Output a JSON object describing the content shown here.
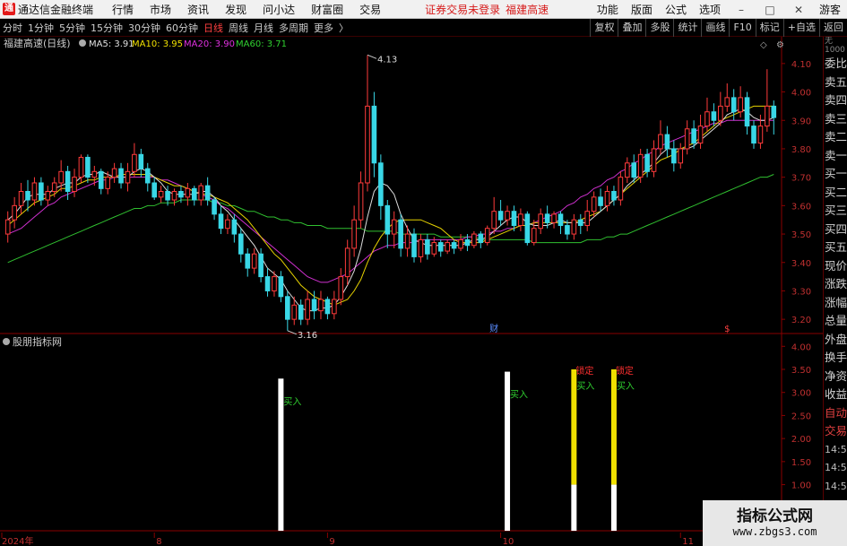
{
  "app": {
    "title": "通达信金融终端",
    "logo": "通"
  },
  "menu": {
    "items": [
      "行情",
      "市场",
      "资讯",
      "发现",
      "问小达",
      "财富圈",
      "交易"
    ],
    "alert": "证券交易未登录",
    "stock": "福建高速",
    "right_items": [
      "功能",
      "版面",
      "公式",
      "选项"
    ],
    "guest": "游客"
  },
  "toolbar": {
    "periods": [
      "分时",
      "1分钟",
      "5分钟",
      "15分钟",
      "30分钟",
      "60分钟",
      "日线",
      "周线",
      "月线",
      "多周期",
      "更多"
    ],
    "active": "日线",
    "right_items": [
      "复权",
      "叠加",
      "多股",
      "统计",
      "画线",
      "F10",
      "标记",
      "+自选",
      "返回"
    ]
  },
  "sidebar": {
    "header": "无",
    "header_sub": "1000",
    "items": [
      "委比",
      "卖五",
      "卖四",
      "卖三",
      "卖二",
      "卖一",
      "买一",
      "买二",
      "买三",
      "买四",
      "买五",
      "现价",
      "涨跌",
      "涨幅",
      "总量",
      "外盘",
      "换手",
      "净资",
      "收益",
      "自动",
      "交易",
      "14:56",
      "14:56",
      "14:56",
      "14:56",
      "14:56",
      "14:56",
      "14:56"
    ]
  },
  "main_chart": {
    "title": "福建高速(日线)",
    "ma_labels": [
      {
        "text": "MA5: 3.91",
        "color": "#e0e0e0"
      },
      {
        "text": "MA10: 3.95",
        "color": "#f0e000"
      },
      {
        "text": "MA20: 3.90",
        "color": "#e030e0"
      },
      {
        "text": "MA60: 3.71",
        "color": "#30d030"
      }
    ],
    "high_label": "4.13",
    "low_label": "3.16",
    "axis_ticks": [
      "4.10",
      "4.00",
      "3.90",
      "3.80",
      "3.70",
      "3.60",
      "3.50",
      "3.40",
      "3.30",
      "3.20"
    ],
    "markers": {
      "cai": "财",
      "dollar": "$"
    }
  },
  "indicator": {
    "title": "股朋指标网",
    "axis_ticks": [
      "4.00",
      "3.50",
      "3.00",
      "2.50",
      "2.00",
      "1.50",
      "1.00",
      "0.50"
    ],
    "buy_label": "买入",
    "lock_label": "锁定"
  },
  "x_axis": {
    "labels": [
      "2024年",
      "8",
      "9",
      "10",
      "11",
      "12",
      "1"
    ]
  },
  "watermark": {
    "line1": "指标公式网",
    "line2": "www.zbgs3.com"
  },
  "chart_data": {
    "type": "candlestick",
    "title": "福建高速(日线)",
    "price_axis": [
      3.15,
      4.15
    ],
    "high": {
      "value": 4.13,
      "label": "4.13"
    },
    "low": {
      "value": 3.16,
      "label": "3.16"
    },
    "candles": [
      [
        3.5,
        3.55,
        3.47,
        3.58
      ],
      [
        3.55,
        3.6,
        3.52,
        3.63
      ],
      [
        3.6,
        3.65,
        3.57,
        3.68
      ],
      [
        3.65,
        3.62,
        3.58,
        3.69
      ],
      [
        3.62,
        3.68,
        3.6,
        3.7
      ],
      [
        3.68,
        3.62,
        3.6,
        3.7
      ],
      [
        3.62,
        3.65,
        3.6,
        3.67
      ],
      [
        3.65,
        3.68,
        3.63,
        3.7
      ],
      [
        3.68,
        3.72,
        3.65,
        3.76
      ],
      [
        3.72,
        3.65,
        3.62,
        3.74
      ],
      [
        3.65,
        3.7,
        3.63,
        3.73
      ],
      [
        3.7,
        3.77,
        3.68,
        3.78
      ],
      [
        3.77,
        3.7,
        3.68,
        3.78
      ],
      [
        3.7,
        3.72,
        3.67,
        3.74
      ],
      [
        3.72,
        3.66,
        3.64,
        3.73
      ],
      [
        3.66,
        3.7,
        3.64,
        3.72
      ],
      [
        3.7,
        3.73,
        3.68,
        3.75
      ],
      [
        3.73,
        3.68,
        3.66,
        3.75
      ],
      [
        3.68,
        3.72,
        3.65,
        3.75
      ],
      [
        3.72,
        3.78,
        3.7,
        3.82
      ],
      [
        3.78,
        3.73,
        3.7,
        3.8
      ],
      [
        3.73,
        3.68,
        3.65,
        3.75
      ],
      [
        3.68,
        3.63,
        3.62,
        3.7
      ],
      [
        3.63,
        3.65,
        3.61,
        3.67
      ],
      [
        3.65,
        3.62,
        3.6,
        3.67
      ],
      [
        3.62,
        3.65,
        3.6,
        3.66
      ],
      [
        3.65,
        3.63,
        3.61,
        3.67
      ],
      [
        3.63,
        3.66,
        3.6,
        3.68
      ],
      [
        3.66,
        3.62,
        3.6,
        3.67
      ],
      [
        3.62,
        3.67,
        3.6,
        3.68
      ],
      [
        3.67,
        3.62,
        3.6,
        3.7
      ],
      [
        3.62,
        3.57,
        3.55,
        3.63
      ],
      [
        3.57,
        3.52,
        3.5,
        3.6
      ],
      [
        3.52,
        3.55,
        3.5,
        3.57
      ],
      [
        3.55,
        3.5,
        3.47,
        3.57
      ],
      [
        3.5,
        3.43,
        3.4,
        3.52
      ],
      [
        3.43,
        3.38,
        3.35,
        3.45
      ],
      [
        3.38,
        3.43,
        3.36,
        3.45
      ],
      [
        3.43,
        3.35,
        3.33,
        3.45
      ],
      [
        3.35,
        3.3,
        3.28,
        3.38
      ],
      [
        3.3,
        3.35,
        3.28,
        3.37
      ],
      [
        3.35,
        3.28,
        3.26,
        3.37
      ],
      [
        3.28,
        3.2,
        3.16,
        3.3
      ],
      [
        3.2,
        3.25,
        3.18,
        3.28
      ],
      [
        3.25,
        3.2,
        3.18,
        3.27
      ],
      [
        3.2,
        3.27,
        3.18,
        3.3
      ],
      [
        3.27,
        3.23,
        3.2,
        3.3
      ],
      [
        3.23,
        3.27,
        3.2,
        3.3
      ],
      [
        3.27,
        3.22,
        3.2,
        3.28
      ],
      [
        3.22,
        3.27,
        3.2,
        3.3
      ],
      [
        3.27,
        3.35,
        3.25,
        3.38
      ],
      [
        3.35,
        3.45,
        3.32,
        3.48
      ],
      [
        3.45,
        3.55,
        3.42,
        3.6
      ],
      [
        3.55,
        3.68,
        3.52,
        3.72
      ],
      [
        3.68,
        3.95,
        3.65,
        4.13
      ],
      [
        3.95,
        3.75,
        3.7,
        4.0
      ],
      [
        3.75,
        3.6,
        3.55,
        3.78
      ],
      [
        3.6,
        3.5,
        3.45,
        3.62
      ],
      [
        3.5,
        3.55,
        3.45,
        3.58
      ],
      [
        3.55,
        3.45,
        3.42,
        3.57
      ],
      [
        3.45,
        3.5,
        3.42,
        3.53
      ],
      [
        3.5,
        3.42,
        3.4,
        3.52
      ],
      [
        3.42,
        3.48,
        3.4,
        3.5
      ],
      [
        3.48,
        3.43,
        3.41,
        3.5
      ],
      [
        3.43,
        3.47,
        3.42,
        3.49
      ],
      [
        3.47,
        3.44,
        3.42,
        3.48
      ],
      [
        3.44,
        3.47,
        3.43,
        3.48
      ],
      [
        3.47,
        3.45,
        3.43,
        3.48
      ],
      [
        3.45,
        3.48,
        3.44,
        3.5
      ],
      [
        3.48,
        3.46,
        3.44,
        3.5
      ],
      [
        3.46,
        3.5,
        3.45,
        3.51
      ],
      [
        3.5,
        3.47,
        3.45,
        3.51
      ],
      [
        3.47,
        3.52,
        3.46,
        3.53
      ],
      [
        3.52,
        3.58,
        3.5,
        3.63
      ],
      [
        3.58,
        3.55,
        3.53,
        3.62
      ],
      [
        3.55,
        3.58,
        3.53,
        3.6
      ],
      [
        3.58,
        3.53,
        3.51,
        3.6
      ],
      [
        3.53,
        3.57,
        3.51,
        3.59
      ],
      [
        3.57,
        3.47,
        3.46,
        3.58
      ],
      [
        3.47,
        3.52,
        3.46,
        3.55
      ],
      [
        3.52,
        3.57,
        3.5,
        3.59
      ],
      [
        3.57,
        3.54,
        3.52,
        3.6
      ],
      [
        3.54,
        3.57,
        3.52,
        3.58
      ],
      [
        3.57,
        3.53,
        3.5,
        3.58
      ],
      [
        3.53,
        3.5,
        3.48,
        3.55
      ],
      [
        3.5,
        3.55,
        3.48,
        3.57
      ],
      [
        3.55,
        3.53,
        3.5,
        3.57
      ],
      [
        3.53,
        3.58,
        3.51,
        3.62
      ],
      [
        3.58,
        3.63,
        3.56,
        3.65
      ],
      [
        3.63,
        3.6,
        3.58,
        3.66
      ],
      [
        3.6,
        3.65,
        3.58,
        3.67
      ],
      [
        3.65,
        3.62,
        3.6,
        3.67
      ],
      [
        3.62,
        3.7,
        3.6,
        3.72
      ],
      [
        3.7,
        3.75,
        3.68,
        3.77
      ],
      [
        3.75,
        3.7,
        3.68,
        3.78
      ],
      [
        3.7,
        3.78,
        3.68,
        3.8
      ],
      [
        3.78,
        3.72,
        3.7,
        3.8
      ],
      [
        3.72,
        3.8,
        3.7,
        3.83
      ],
      [
        3.8,
        3.85,
        3.78,
        3.9
      ],
      [
        3.85,
        3.8,
        3.77,
        3.88
      ],
      [
        3.8,
        3.75,
        3.72,
        3.83
      ],
      [
        3.75,
        3.8,
        3.73,
        3.82
      ],
      [
        3.8,
        3.87,
        3.78,
        3.9
      ],
      [
        3.87,
        3.82,
        3.8,
        3.9
      ],
      [
        3.82,
        3.88,
        3.8,
        3.92
      ],
      [
        3.88,
        3.93,
        3.86,
        3.98
      ],
      [
        3.93,
        3.9,
        3.88,
        3.96
      ],
      [
        3.9,
        3.95,
        3.88,
        4.0
      ],
      [
        3.95,
        3.98,
        3.93,
        4.03
      ],
      [
        3.98,
        3.93,
        3.9,
        4.01
      ],
      [
        3.93,
        3.98,
        3.91,
        4.02
      ],
      [
        3.98,
        3.88,
        3.85,
        4.0
      ],
      [
        3.88,
        3.82,
        3.8,
        3.9
      ],
      [
        3.82,
        3.88,
        3.8,
        3.92
      ],
      [
        3.88,
        3.95,
        3.86,
        4.08
      ],
      [
        3.95,
        3.91,
        3.85,
        3.97
      ]
    ],
    "ma_current": {
      "MA5": 3.91,
      "MA10": 3.95,
      "MA20": 3.9,
      "MA60": 3.71
    },
    "ma5": [
      3.55,
      3.57,
      3.6,
      3.63,
      3.64,
      3.64,
      3.64,
      3.66,
      3.67,
      3.68,
      3.68,
      3.7,
      3.71,
      3.71,
      3.72,
      3.71,
      3.7,
      3.7,
      3.7,
      3.72,
      3.73,
      3.72,
      3.7,
      3.68,
      3.65,
      3.64,
      3.64,
      3.64,
      3.64,
      3.65,
      3.65,
      3.63,
      3.6,
      3.58,
      3.55,
      3.52,
      3.49,
      3.46,
      3.42,
      3.38,
      3.36,
      3.34,
      3.3,
      3.27,
      3.24,
      3.23,
      3.23,
      3.24,
      3.24,
      3.25,
      3.28,
      3.32,
      3.37,
      3.45,
      3.56,
      3.65,
      3.68,
      3.67,
      3.64,
      3.57,
      3.52,
      3.48,
      3.47,
      3.46,
      3.46,
      3.46,
      3.46,
      3.46,
      3.46,
      3.47,
      3.48,
      3.48,
      3.49,
      3.51,
      3.53,
      3.55,
      3.56,
      3.56,
      3.54,
      3.53,
      3.53,
      3.53,
      3.54,
      3.55,
      3.54,
      3.54,
      3.54,
      3.54,
      3.56,
      3.58,
      3.6,
      3.62,
      3.64,
      3.67,
      3.69,
      3.71,
      3.73,
      3.75,
      3.78,
      3.8,
      3.8,
      3.8,
      3.8,
      3.81,
      3.83,
      3.85,
      3.87,
      3.89,
      3.92,
      3.93,
      3.94,
      3.93,
      3.91,
      3.9,
      3.9,
      3.91
    ],
    "ma10": [
      3.53,
      3.55,
      3.57,
      3.59,
      3.61,
      3.62,
      3.63,
      3.64,
      3.66,
      3.66,
      3.67,
      3.68,
      3.69,
      3.69,
      3.7,
      3.7,
      3.7,
      3.71,
      3.71,
      3.71,
      3.71,
      3.71,
      3.7,
      3.69,
      3.68,
      3.67,
      3.67,
      3.66,
      3.65,
      3.64,
      3.64,
      3.63,
      3.62,
      3.61,
      3.59,
      3.57,
      3.55,
      3.52,
      3.49,
      3.46,
      3.43,
      3.41,
      3.38,
      3.35,
      3.32,
      3.3,
      3.28,
      3.27,
      3.26,
      3.25,
      3.26,
      3.27,
      3.3,
      3.34,
      3.4,
      3.45,
      3.49,
      3.52,
      3.54,
      3.55,
      3.55,
      3.55,
      3.55,
      3.54,
      3.53,
      3.52,
      3.5,
      3.48,
      3.47,
      3.47,
      3.47,
      3.47,
      3.48,
      3.49,
      3.5,
      3.51,
      3.52,
      3.53,
      3.53,
      3.54,
      3.54,
      3.54,
      3.54,
      3.54,
      3.54,
      3.54,
      3.55,
      3.56,
      3.57,
      3.58,
      3.6,
      3.62,
      3.64,
      3.66,
      3.68,
      3.7,
      3.72,
      3.74,
      3.76,
      3.77,
      3.78,
      3.8,
      3.81,
      3.82,
      3.84,
      3.86,
      3.88,
      3.9,
      3.91,
      3.92,
      3.93,
      3.94,
      3.95,
      3.95,
      3.95,
      3.95
    ],
    "ma20": [
      3.5,
      3.51,
      3.52,
      3.54,
      3.56,
      3.58,
      3.6,
      3.61,
      3.63,
      3.64,
      3.65,
      3.66,
      3.67,
      3.68,
      3.69,
      3.69,
      3.7,
      3.7,
      3.7,
      3.7,
      3.7,
      3.7,
      3.7,
      3.69,
      3.69,
      3.68,
      3.67,
      3.66,
      3.65,
      3.64,
      3.63,
      3.62,
      3.6,
      3.59,
      3.57,
      3.55,
      3.53,
      3.51,
      3.49,
      3.47,
      3.45,
      3.43,
      3.41,
      3.39,
      3.37,
      3.35,
      3.34,
      3.33,
      3.33,
      3.34,
      3.35,
      3.36,
      3.38,
      3.4,
      3.42,
      3.44,
      3.45,
      3.46,
      3.46,
      3.47,
      3.47,
      3.47,
      3.48,
      3.48,
      3.48,
      3.48,
      3.48,
      3.48,
      3.48,
      3.49,
      3.49,
      3.5,
      3.5,
      3.51,
      3.51,
      3.52,
      3.52,
      3.53,
      3.53,
      3.54,
      3.55,
      3.56,
      3.57,
      3.58,
      3.6,
      3.61,
      3.63,
      3.64,
      3.66,
      3.67,
      3.69,
      3.7,
      3.72,
      3.73,
      3.75,
      3.76,
      3.78,
      3.79,
      3.81,
      3.82,
      3.83,
      3.84,
      3.85,
      3.86,
      3.87,
      3.88,
      3.89,
      3.89,
      3.9,
      3.9,
      3.9,
      3.9,
      3.9,
      3.9,
      3.9,
      3.9
    ],
    "ma60": [
      3.4,
      3.41,
      3.42,
      3.43,
      3.44,
      3.45,
      3.46,
      3.47,
      3.48,
      3.49,
      3.5,
      3.51,
      3.52,
      3.53,
      3.54,
      3.55,
      3.56,
      3.57,
      3.58,
      3.59,
      3.59,
      3.6,
      3.6,
      3.61,
      3.61,
      3.61,
      3.62,
      3.62,
      3.62,
      3.62,
      3.62,
      3.61,
      3.61,
      3.6,
      3.6,
      3.59,
      3.58,
      3.58,
      3.57,
      3.56,
      3.56,
      3.55,
      3.55,
      3.54,
      3.54,
      3.53,
      3.53,
      3.53,
      3.52,
      3.52,
      3.52,
      3.52,
      3.52,
      3.52,
      3.51,
      3.51,
      3.51,
      3.51,
      3.51,
      3.5,
      3.5,
      3.5,
      3.5,
      3.5,
      3.5,
      3.49,
      3.49,
      3.49,
      3.49,
      3.49,
      3.49,
      3.48,
      3.48,
      3.48,
      3.48,
      3.48,
      3.48,
      3.48,
      3.48,
      3.47,
      3.47,
      3.47,
      3.47,
      3.47,
      3.47,
      3.47,
      3.47,
      3.48,
      3.48,
      3.48,
      3.49,
      3.49,
      3.5,
      3.5,
      3.51,
      3.52,
      3.53,
      3.54,
      3.55,
      3.56,
      3.57,
      3.58,
      3.59,
      3.6,
      3.61,
      3.62,
      3.63,
      3.64,
      3.65,
      3.66,
      3.67,
      3.68,
      3.69,
      3.7,
      3.7,
      3.71
    ],
    "signals": [
      {
        "index": 41,
        "height": 3.3,
        "low_color": "#ffffff",
        "high_color": "#ffffff",
        "label": "买入"
      },
      {
        "index": 75,
        "height": 3.45,
        "low_color": "#ffffff",
        "high_color": "#ffffff",
        "label": "买入"
      },
      {
        "index": 85,
        "height": 3.5,
        "low_color": "#ffffff",
        "high_color": "#f0e000",
        "label": "买入",
        "label2": "锁定"
      },
      {
        "index": 91,
        "height": 3.5,
        "low_color": "#ffffff",
        "high_color": "#f0e000",
        "label": "买入",
        "label2": "锁定"
      }
    ],
    "indicator_axis": [
      0,
      4.2
    ]
  }
}
